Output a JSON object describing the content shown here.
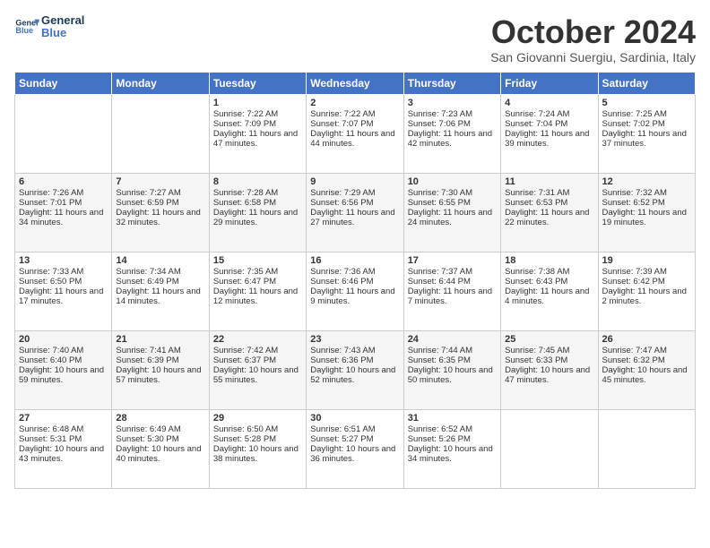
{
  "logo": {
    "line1": "General",
    "line2": "Blue"
  },
  "title": "October 2024",
  "subtitle": "San Giovanni Suergiu, Sardinia, Italy",
  "days": [
    "Sunday",
    "Monday",
    "Tuesday",
    "Wednesday",
    "Thursday",
    "Friday",
    "Saturday"
  ],
  "weeks": [
    [
      {
        "date": "",
        "info": ""
      },
      {
        "date": "",
        "info": ""
      },
      {
        "date": "1",
        "info": "Sunrise: 7:22 AM\nSunset: 7:09 PM\nDaylight: 11 hours and 47 minutes."
      },
      {
        "date": "2",
        "info": "Sunrise: 7:22 AM\nSunset: 7:07 PM\nDaylight: 11 hours and 44 minutes."
      },
      {
        "date": "3",
        "info": "Sunrise: 7:23 AM\nSunset: 7:06 PM\nDaylight: 11 hours and 42 minutes."
      },
      {
        "date": "4",
        "info": "Sunrise: 7:24 AM\nSunset: 7:04 PM\nDaylight: 11 hours and 39 minutes."
      },
      {
        "date": "5",
        "info": "Sunrise: 7:25 AM\nSunset: 7:02 PM\nDaylight: 11 hours and 37 minutes."
      }
    ],
    [
      {
        "date": "6",
        "info": "Sunrise: 7:26 AM\nSunset: 7:01 PM\nDaylight: 11 hours and 34 minutes."
      },
      {
        "date": "7",
        "info": "Sunrise: 7:27 AM\nSunset: 6:59 PM\nDaylight: 11 hours and 32 minutes."
      },
      {
        "date": "8",
        "info": "Sunrise: 7:28 AM\nSunset: 6:58 PM\nDaylight: 11 hours and 29 minutes."
      },
      {
        "date": "9",
        "info": "Sunrise: 7:29 AM\nSunset: 6:56 PM\nDaylight: 11 hours and 27 minutes."
      },
      {
        "date": "10",
        "info": "Sunrise: 7:30 AM\nSunset: 6:55 PM\nDaylight: 11 hours and 24 minutes."
      },
      {
        "date": "11",
        "info": "Sunrise: 7:31 AM\nSunset: 6:53 PM\nDaylight: 11 hours and 22 minutes."
      },
      {
        "date": "12",
        "info": "Sunrise: 7:32 AM\nSunset: 6:52 PM\nDaylight: 11 hours and 19 minutes."
      }
    ],
    [
      {
        "date": "13",
        "info": "Sunrise: 7:33 AM\nSunset: 6:50 PM\nDaylight: 11 hours and 17 minutes."
      },
      {
        "date": "14",
        "info": "Sunrise: 7:34 AM\nSunset: 6:49 PM\nDaylight: 11 hours and 14 minutes."
      },
      {
        "date": "15",
        "info": "Sunrise: 7:35 AM\nSunset: 6:47 PM\nDaylight: 11 hours and 12 minutes."
      },
      {
        "date": "16",
        "info": "Sunrise: 7:36 AM\nSunset: 6:46 PM\nDaylight: 11 hours and 9 minutes."
      },
      {
        "date": "17",
        "info": "Sunrise: 7:37 AM\nSunset: 6:44 PM\nDaylight: 11 hours and 7 minutes."
      },
      {
        "date": "18",
        "info": "Sunrise: 7:38 AM\nSunset: 6:43 PM\nDaylight: 11 hours and 4 minutes."
      },
      {
        "date": "19",
        "info": "Sunrise: 7:39 AM\nSunset: 6:42 PM\nDaylight: 11 hours and 2 minutes."
      }
    ],
    [
      {
        "date": "20",
        "info": "Sunrise: 7:40 AM\nSunset: 6:40 PM\nDaylight: 10 hours and 59 minutes."
      },
      {
        "date": "21",
        "info": "Sunrise: 7:41 AM\nSunset: 6:39 PM\nDaylight: 10 hours and 57 minutes."
      },
      {
        "date": "22",
        "info": "Sunrise: 7:42 AM\nSunset: 6:37 PM\nDaylight: 10 hours and 55 minutes."
      },
      {
        "date": "23",
        "info": "Sunrise: 7:43 AM\nSunset: 6:36 PM\nDaylight: 10 hours and 52 minutes."
      },
      {
        "date": "24",
        "info": "Sunrise: 7:44 AM\nSunset: 6:35 PM\nDaylight: 10 hours and 50 minutes."
      },
      {
        "date": "25",
        "info": "Sunrise: 7:45 AM\nSunset: 6:33 PM\nDaylight: 10 hours and 47 minutes."
      },
      {
        "date": "26",
        "info": "Sunrise: 7:47 AM\nSunset: 6:32 PM\nDaylight: 10 hours and 45 minutes."
      }
    ],
    [
      {
        "date": "27",
        "info": "Sunrise: 6:48 AM\nSunset: 5:31 PM\nDaylight: 10 hours and 43 minutes."
      },
      {
        "date": "28",
        "info": "Sunrise: 6:49 AM\nSunset: 5:30 PM\nDaylight: 10 hours and 40 minutes."
      },
      {
        "date": "29",
        "info": "Sunrise: 6:50 AM\nSunset: 5:28 PM\nDaylight: 10 hours and 38 minutes."
      },
      {
        "date": "30",
        "info": "Sunrise: 6:51 AM\nSunset: 5:27 PM\nDaylight: 10 hours and 36 minutes."
      },
      {
        "date": "31",
        "info": "Sunrise: 6:52 AM\nSunset: 5:26 PM\nDaylight: 10 hours and 34 minutes."
      },
      {
        "date": "",
        "info": ""
      },
      {
        "date": "",
        "info": ""
      }
    ]
  ]
}
